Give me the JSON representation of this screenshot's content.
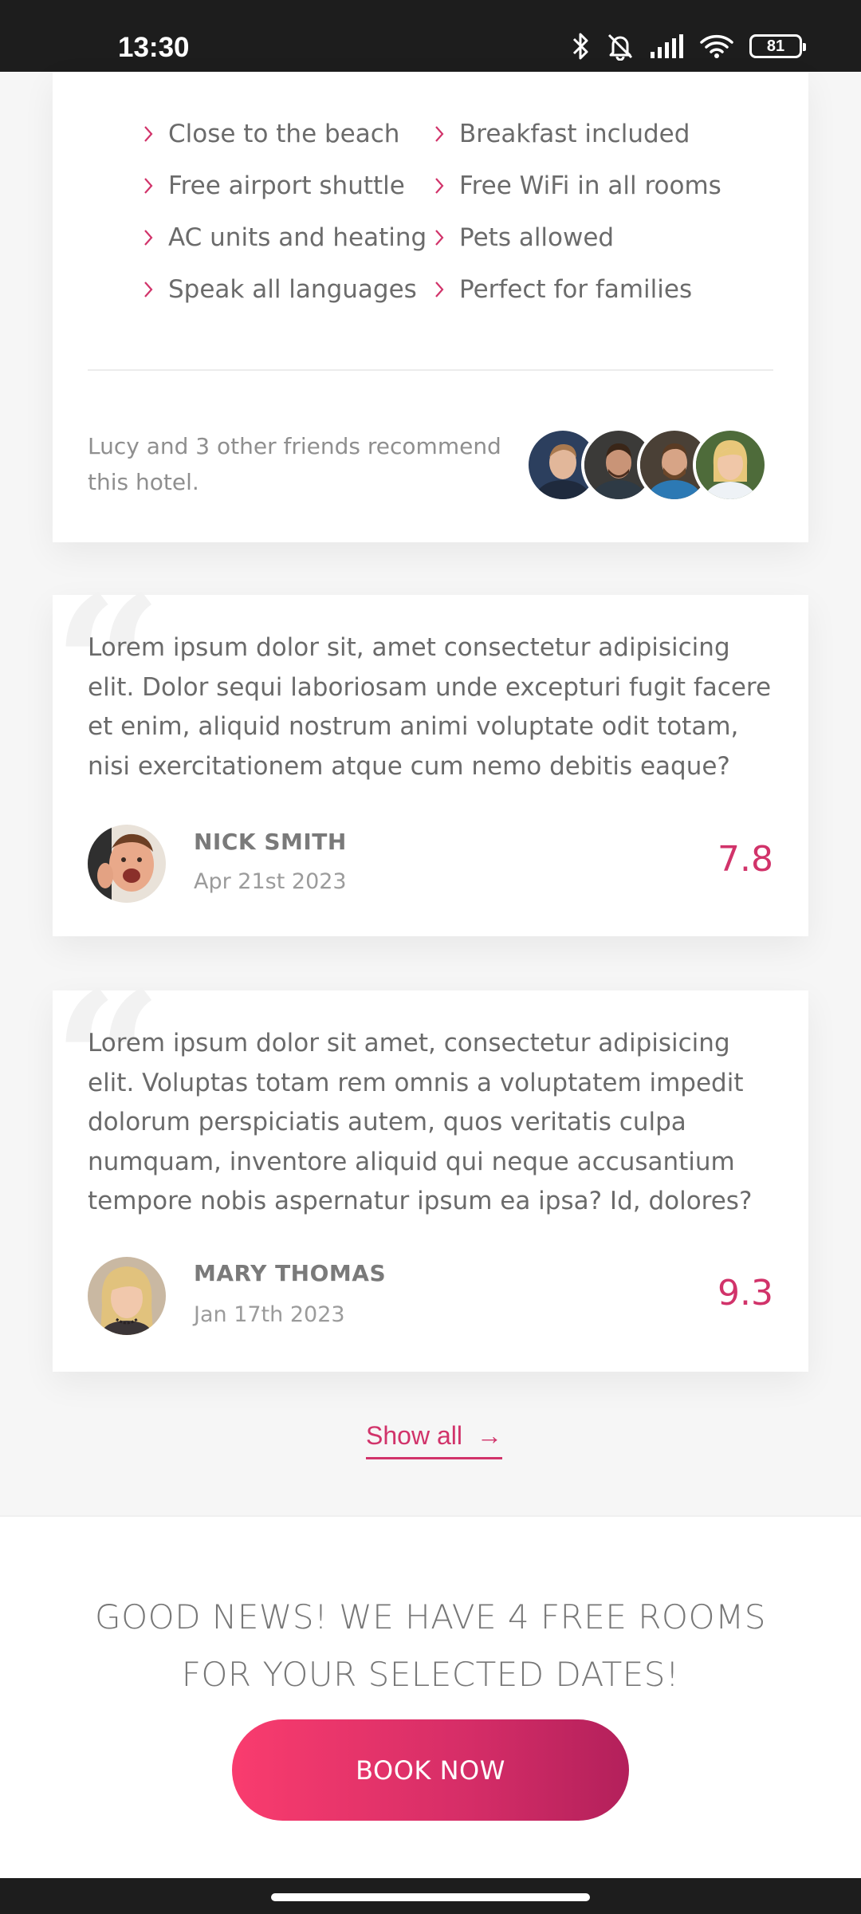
{
  "status_bar": {
    "time": "13:30",
    "battery": "81",
    "icons": [
      "bluetooth-icon",
      "mute-icon",
      "signal-icon",
      "wifi-icon",
      "battery-icon"
    ]
  },
  "amenities": {
    "items": [
      "Close to the beach",
      "Breakfast included",
      "Free airport shuttle",
      "Free WiFi in all rooms",
      "AC units and heating",
      "Pets allowed",
      "Speak all languages",
      "Perfect for families"
    ]
  },
  "recommendation": {
    "text": "Lucy and 3 other friends recommend this hotel."
  },
  "reviews": [
    {
      "text": "Lorem ipsum dolor sit, amet consectetur adipisicing elit. Dolor sequi laboriosam unde excepturi fugit facere et enim, aliquid nostrum animi voluptate odit totam, nisi exercitationem atque cum nemo debitis eaque?",
      "name": "NICK SMITH",
      "date": "Apr 21st 2023",
      "score": "7.8"
    },
    {
      "text": "Lorem ipsum dolor sit amet, consectetur adipisicing elit. Voluptas totam rem omnis a voluptatem impedit dolorum perspiciatis autem, quos veritatis culpa numquam, inventore aliquid qui neque accusantium tempore nobis aspernatur ipsum ea ipsa? Id, dolores?",
      "name": "MARY THOMAS",
      "date": "Jan 17th 2023",
      "score": "9.3"
    }
  ],
  "show_all": {
    "label": "Show all",
    "arrow": "→"
  },
  "availability": {
    "title": "GOOD NEWS! WE HAVE 4 FREE ROOMS FOR YOUR SELECTED DATES!",
    "button": "BOOK NOW"
  },
  "colors": {
    "accent": "#d1336a",
    "button_gradient_start": "#f93c6e",
    "button_gradient_end": "#b3205b"
  }
}
